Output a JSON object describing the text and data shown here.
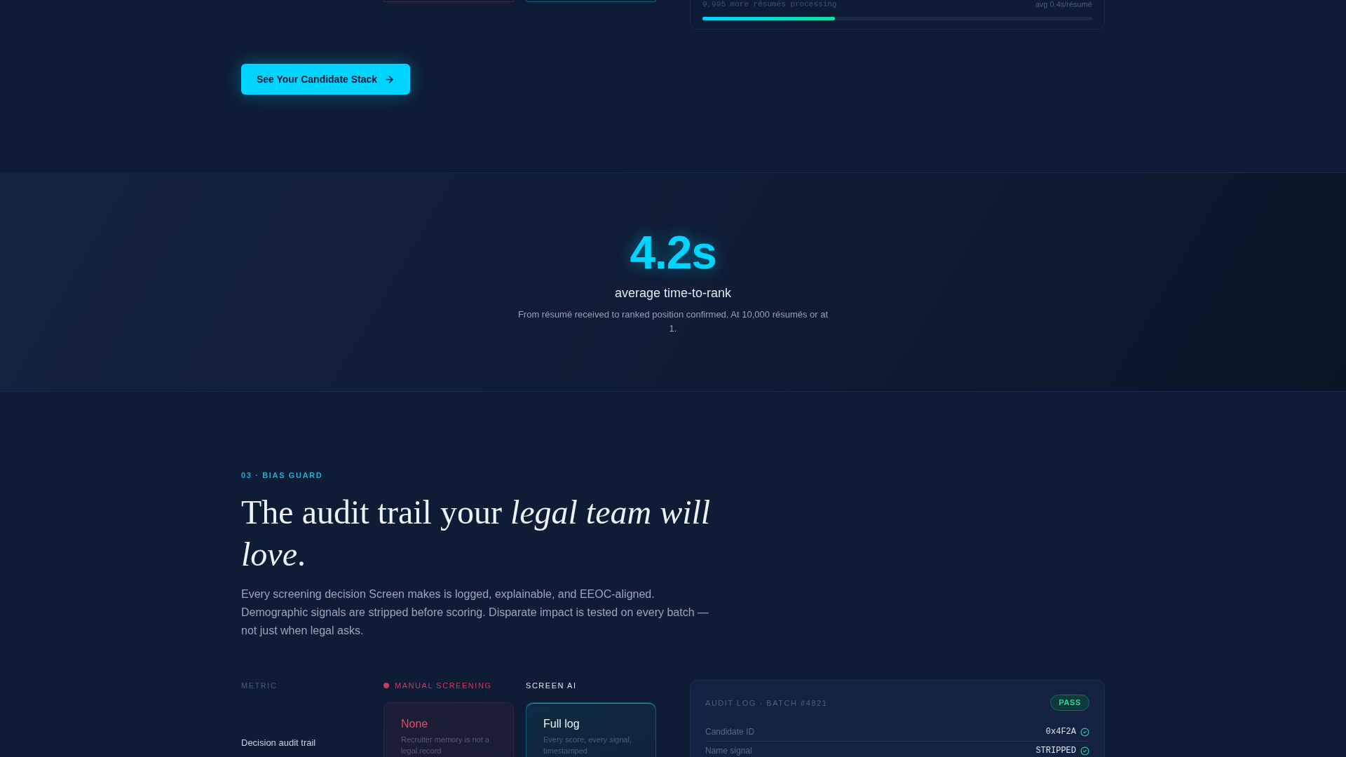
{
  "processing_panel": {
    "status": "9,995 more résumés processing",
    "rate": "avg 0.4s/résumé",
    "progress": {
      "level": 0.34
    }
  },
  "cta_button": {
    "label": "See Your Candidate Stack"
  },
  "stat": {
    "value": "4.2s",
    "label": "average time-to-rank",
    "description": "From résumé received to ranked position confirmed. At 10,000 résumés or at 1."
  },
  "bias_guard": {
    "eyebrow": "03 · BIAS GUARD",
    "heading": "The audit trail your *legal team will love*.",
    "body": "Every screening decision Screen makes is logged, explainable, and EEOC-aligned. Demographic signals are stripped before scoring. Disparate impact is tested on every batch — not just when legal asks.",
    "comparison": {
      "columns": [
        {
          "kind": "metric",
          "label": "METRIC"
        },
        {
          "kind": "manual",
          "label": "MANUAL SCREENING"
        },
        {
          "kind": "ai",
          "label": "SCREEN AI"
        }
      ],
      "rows": [
        {
          "metric": "Decision audit trail",
          "manual": {
            "value": "None",
            "note": "Recruiter memory is not a legal record"
          },
          "ai": {
            "value": "Full log",
            "note": "Every score, every signal, timestamped"
          }
        }
      ]
    },
    "audit_log": {
      "title": "AUDIT LOG · BATCH #4821",
      "status": "PASS",
      "rows": [
        {
          "label": "Candidate ID",
          "value": "0x4F2A",
          "verified": true
        },
        {
          "label": "Name signal",
          "value": "STRIPPED",
          "verified": true
        }
      ]
    }
  }
}
